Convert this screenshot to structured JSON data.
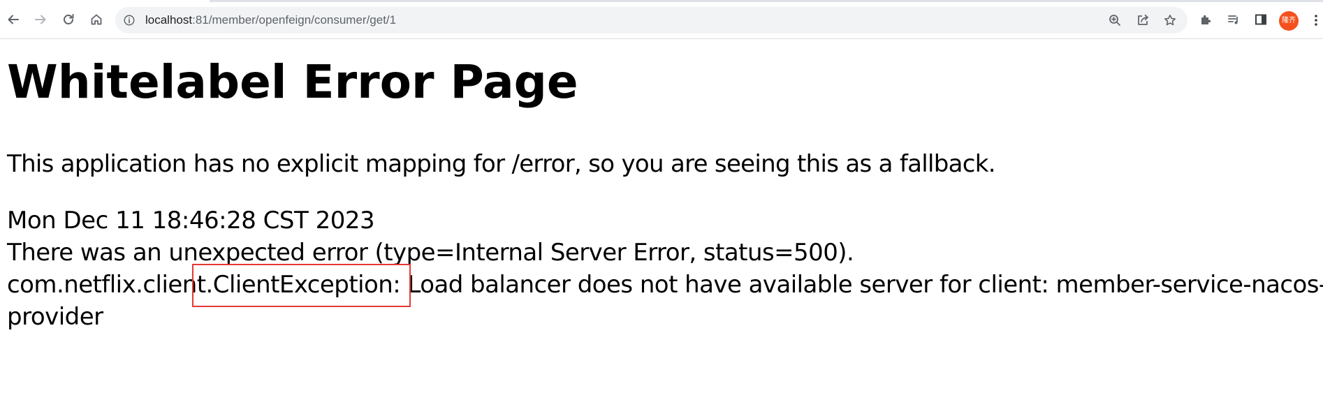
{
  "browser": {
    "url_host": "localhost",
    "url_path": ":81/member/openfeign/consumer/get/1",
    "profile_avatar_text": "隆齐",
    "icons": {
      "back": "arrow-left-icon",
      "forward": "arrow-right-icon",
      "reload": "reload-icon",
      "home": "home-icon",
      "site_info": "info-circle-icon",
      "zoom": "zoom-icon",
      "share": "share-icon",
      "bookmark": "star-icon",
      "extensions": "puzzle-icon",
      "reading_list": "reading-list-icon",
      "side_panel": "side-panel-icon",
      "menu": "kebab-menu-icon"
    },
    "colors": {
      "avatar_bg": "#f4511e",
      "omnibox_bg": "#f1f3f4",
      "annotation_border": "#e53935"
    }
  },
  "page": {
    "title": "Whitelabel Error Page",
    "message": "This application has no explicit mapping for /error, so you are seeing this as a fallback.",
    "timestamp": "Mon Dec 11 18:46:28 CST 2023",
    "error_line": "There was an unexpected error (type=Internal Server Error, status=500).",
    "exception_line_1": "com.netflix.client.ClientException: Load balancer does not have available server for client: member-service-nacos-",
    "exception_line_2": "provider"
  }
}
